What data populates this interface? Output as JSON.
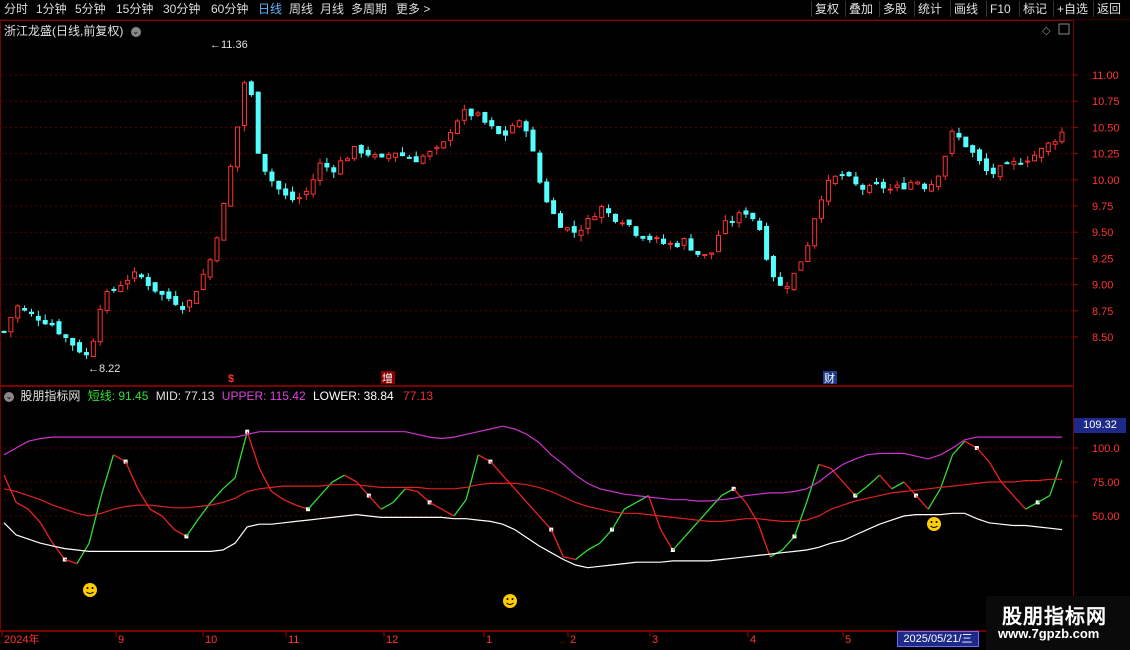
{
  "toolbar": {
    "periods": [
      "分时",
      "1分钟",
      "5分钟",
      "15分钟",
      "30分钟",
      "60分钟",
      "日线",
      "周线",
      "月线",
      "多周期",
      "更多 >"
    ],
    "active_period": "日线",
    "right_buttons": [
      "复权",
      "叠加",
      "多股",
      "统计",
      "画线",
      "F10",
      "标记",
      "+自选",
      "返回"
    ]
  },
  "main_title": "浙江龙盛(日线,前复权)",
  "indicator": {
    "name": "股朋指标网",
    "short_label": "短线: 91.45",
    "mid_label": "MID: 77.13",
    "upper_label": "UPPER: 115.42",
    "lower_label": "LOWER: 38.84",
    "extra_label": "77.13",
    "right_value": "109.32"
  },
  "event_markers": [
    "$",
    "增",
    "财"
  ],
  "x_axis": [
    "2024年",
    "9",
    "10",
    "11",
    "12",
    "1",
    "2",
    "3",
    "4",
    "5"
  ],
  "date_box": "2025/05/21/三",
  "watermark": {
    "line1": "股朋指标网",
    "line2": "www.7gpzb.com"
  },
  "colors": {
    "up": "#ff3333",
    "down": "#54ffff",
    "short_up": "#33dd33",
    "short_down": "#ee2222",
    "mid": "#dd2222",
    "upper": "#cc33cc",
    "lower": "#ffffff",
    "ma": "#ffffff"
  },
  "chart_data": [
    {
      "type": "candlestick",
      "title": "浙江龙盛(日线,前复权)",
      "y_ticks": [
        8.5,
        8.75,
        9.0,
        9.25,
        9.5,
        9.75,
        10.0,
        10.25,
        10.5,
        10.75,
        11.0
      ],
      "annotations": {
        "high": "11.36",
        "low": "8.22"
      },
      "close_path": [
        8.55,
        8.8,
        8.72,
        8.68,
        8.62,
        8.5,
        8.4,
        8.3,
        8.85,
        8.95,
        9.05,
        9.1,
        9.0,
        8.9,
        8.85,
        8.78,
        9.0,
        9.25,
        9.7,
        10.35,
        11.1,
        10.2,
        10.0,
        9.85,
        9.8,
        9.9,
        10.15,
        10.1,
        10.2,
        10.3,
        10.25,
        10.18,
        10.28,
        10.22,
        10.2,
        10.25,
        10.3,
        10.55,
        10.65,
        10.6,
        10.5,
        10.4,
        10.55,
        10.5,
        10.0,
        9.7,
        9.55,
        9.5,
        9.6,
        9.75,
        9.65,
        9.62,
        9.5,
        9.45,
        9.4,
        9.38,
        9.42,
        9.3,
        9.25,
        9.55,
        9.62,
        9.7,
        9.6,
        9.15,
        8.95,
        9.1,
        9.35,
        9.8,
        10.0,
        10.05,
        9.95,
        9.9,
        9.95,
        9.9,
        9.95,
        10.0,
        9.92,
        10.1,
        10.45,
        10.35,
        10.2,
        10.05,
        10.1,
        10.15,
        10.2,
        10.25,
        10.35,
        10.45
      ]
    },
    {
      "type": "line",
      "title": "股朋指标网",
      "y_ticks": [
        50.0,
        75.0,
        100.0
      ],
      "series": [
        {
          "name": "短线",
          "values": [
            80,
            60,
            55,
            45,
            30,
            18,
            15,
            30,
            65,
            95,
            90,
            70,
            55,
            50,
            40,
            35,
            48,
            60,
            70,
            78,
            112,
            85,
            68,
            62,
            58,
            55,
            65,
            75,
            80,
            75,
            65,
            55,
            60,
            70,
            68,
            60,
            55,
            50,
            62,
            95,
            90,
            80,
            70,
            60,
            50,
            40,
            20,
            18,
            25,
            30,
            40,
            55,
            60,
            65,
            40,
            25,
            35,
            45,
            55,
            65,
            70,
            60,
            45,
            20,
            25,
            35,
            60,
            88,
            85,
            75,
            65,
            72,
            80,
            70,
            75,
            65,
            55,
            70,
            95,
            105,
            100,
            90,
            75,
            65,
            55,
            60,
            65,
            91
          ]
        },
        {
          "name": "MID",
          "values": [
            70,
            68,
            65,
            62,
            58,
            55,
            52,
            50,
            52,
            55,
            57,
            58,
            58,
            57,
            56,
            56,
            57,
            58,
            60,
            63,
            68,
            70,
            71,
            72,
            72,
            72,
            72,
            73,
            73,
            73,
            72,
            71,
            71,
            71,
            71,
            70,
            70,
            70,
            71,
            73,
            74,
            74,
            74,
            73,
            71,
            68,
            64,
            60,
            57,
            55,
            53,
            52,
            52,
            51,
            50,
            49,
            48,
            47,
            46,
            46,
            47,
            48,
            48,
            47,
            46,
            46,
            47,
            50,
            55,
            58,
            61,
            63,
            65,
            67,
            68,
            69,
            70,
            71,
            72,
            73,
            74,
            75,
            75,
            75,
            76,
            76,
            77,
            77
          ]
        },
        {
          "name": "UPPER",
          "values": [
            95,
            100,
            105,
            107,
            108,
            108,
            108,
            108,
            108,
            108,
            108,
            108,
            108,
            108,
            108,
            108,
            108,
            108,
            108,
            108,
            110,
            112,
            112,
            112,
            112,
            112,
            112,
            112,
            112,
            112,
            112,
            112,
            112,
            112,
            110,
            108,
            107,
            108,
            110,
            112,
            114,
            116,
            114,
            110,
            104,
            95,
            88,
            80,
            74,
            70,
            68,
            66,
            65,
            64,
            63,
            62,
            62,
            61,
            61,
            62,
            63,
            65,
            66,
            67,
            67,
            68,
            70,
            75,
            82,
            88,
            92,
            95,
            96,
            96,
            96,
            94,
            92,
            95,
            100,
            106,
            108,
            108,
            108,
            108,
            108,
            108,
            108,
            108
          ]
        },
        {
          "name": "LOWER",
          "values": [
            45,
            36,
            33,
            30,
            28,
            26,
            25,
            24,
            24,
            24,
            24,
            24,
            24,
            24,
            24,
            24,
            24,
            24,
            25,
            30,
            42,
            44,
            44,
            45,
            46,
            47,
            48,
            49,
            50,
            51,
            50,
            49,
            49,
            49,
            49,
            49,
            49,
            48,
            48,
            47,
            46,
            44,
            40,
            34,
            28,
            23,
            18,
            14,
            12,
            13,
            14,
            15,
            16,
            16,
            16,
            17,
            17,
            17,
            17,
            18,
            19,
            20,
            21,
            22,
            23,
            24,
            25,
            27,
            30,
            32,
            36,
            40,
            44,
            47,
            50,
            51,
            51,
            51,
            52,
            52,
            48,
            45,
            44,
            43,
            43,
            42,
            41,
            40
          ]
        }
      ]
    }
  ]
}
